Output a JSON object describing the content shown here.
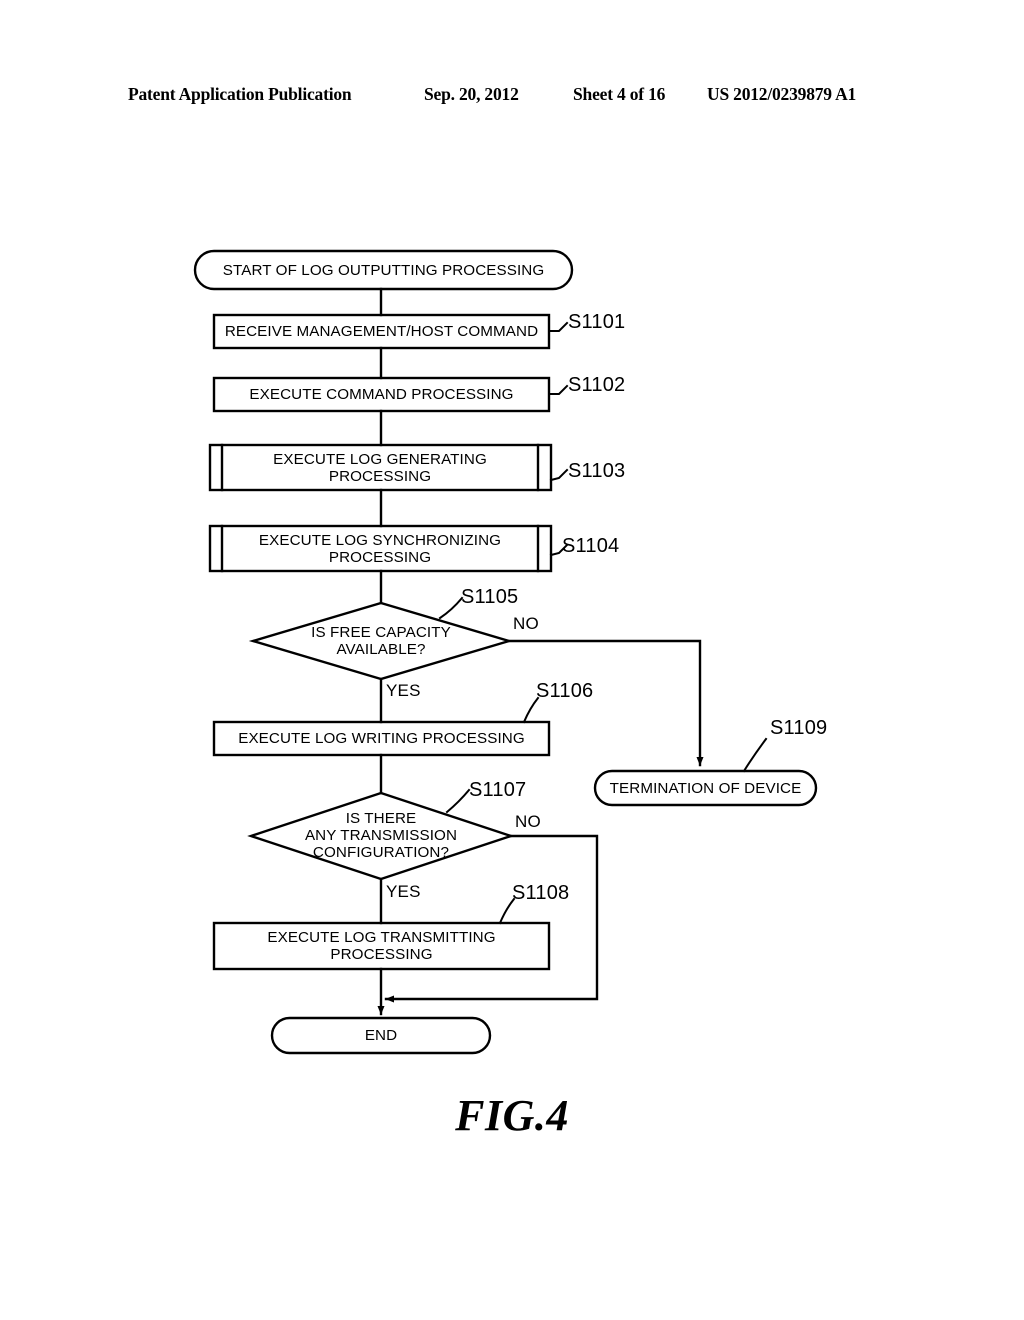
{
  "header": {
    "publication": "Patent Application Publication",
    "date": "Sep. 20, 2012",
    "sheet": "Sheet 4 of 16",
    "number": "US 2012/0239879 A1"
  },
  "figure": {
    "caption": "FIG.4"
  },
  "flowchart": {
    "nodes": {
      "start": "START OF LOG OUTPUTTING PROCESSING",
      "receive_command": "RECEIVE MANAGEMENT/HOST COMMAND",
      "execute_command": "EXECUTE COMMAND PROCESSING",
      "log_generating": "EXECUTE LOG GENERATING\nPROCESSING",
      "log_synchronizing": "EXECUTE LOG SYNCHRONIZING\nPROCESSING",
      "free_capacity": "IS FREE CAPACITY\nAVAILABLE?",
      "log_writing": "EXECUTE LOG WRITING PROCESSING",
      "transmission_config": "IS THERE\nANY TRANSMISSION\nCONFIGURATION?",
      "log_transmitting": "EXECUTE LOG TRANSMITTING\nPROCESSING",
      "termination": "TERMINATION OF DEVICE",
      "end": "END"
    },
    "step_labels": {
      "s1101": "S1101",
      "s1102": "S1102",
      "s1103": "S1103",
      "s1104": "S1104",
      "s1105": "S1105",
      "s1106": "S1106",
      "s1107": "S1107",
      "s1108": "S1108",
      "s1109": "S1109"
    },
    "branch_labels": {
      "free_capacity_no": "NO",
      "free_capacity_yes": "YES",
      "transmission_no": "NO",
      "transmission_yes": "YES"
    }
  },
  "colors": {
    "ink": "#000000",
    "paper": "#ffffff"
  }
}
